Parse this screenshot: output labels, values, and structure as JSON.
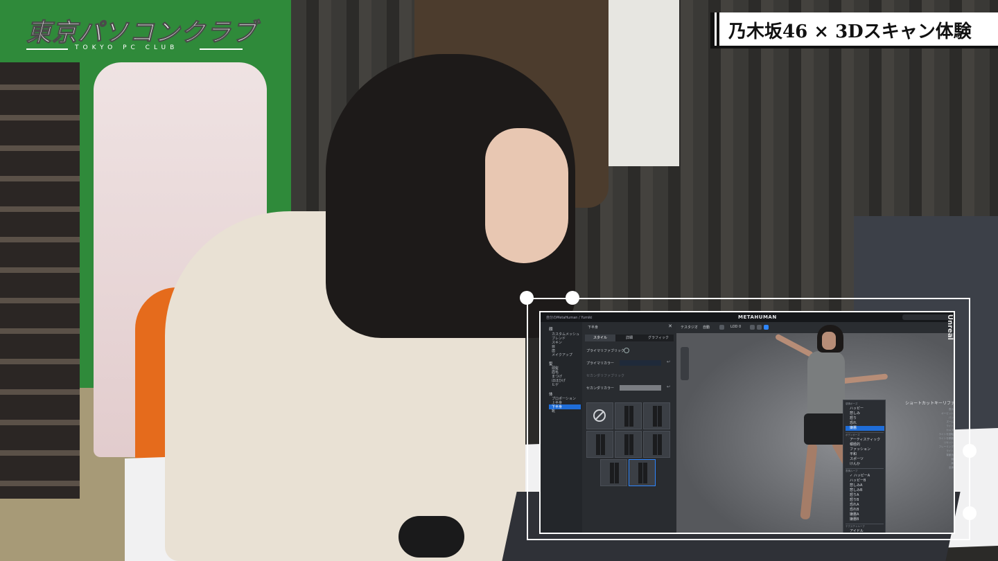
{
  "overlay": {
    "logo_text": "東京パソコンクラブ",
    "logo_subtext": "TOKYO PC CLUB",
    "ticker_title": "乃木坂46 × 3Dスキャン体験"
  },
  "app": {
    "brand": "METAHUMAN",
    "breadcrumb": "自分のMetaHuman / Yumiki",
    "panel_title": "下半身",
    "panel_close": "✕",
    "tabs": [
      {
        "label": "スタイル"
      },
      {
        "label": "詳細"
      },
      {
        "label": "グラフィック"
      }
    ],
    "sidebar": {
      "groups": [
        {
          "label": "顔",
          "items": [
            "カスタムメッシュ",
            "ブレンド",
            "スキン",
            "目",
            "歯",
            "メイクアップ"
          ]
        },
        {
          "label": "髪",
          "items": [
            "頭髪",
            "眉毛",
            "まつげ",
            "ほほひげ",
            "ヒゲ"
          ]
        },
        {
          "label": "体",
          "items": [
            "プロポーション",
            "上半身",
            "下半身",
            "靴"
          ]
        }
      ],
      "selected": "下半身"
    },
    "properties": [
      {
        "label": "プライマリファブリック"
      },
      {
        "label": "プライマリカラー"
      },
      {
        "label": "セカンダリファブリック"
      },
      {
        "label": "セカンダリカラー"
      }
    ],
    "reset_icon": "↩",
    "viewport_toolbar": [
      "テスタジオ",
      "自動",
      "LOD 0"
    ],
    "dropdown": {
      "sections": [
        {
          "header": "感情ポーズ",
          "items": [
            "ハッピー",
            "悲しみ",
            "怒り",
            "恐れ",
            "嫌悪"
          ],
          "selected": "嫌悪"
        },
        {
          "header": "ボディポーズ",
          "items": [
            "アーティスティック",
            "積極的",
            "ファッション",
            "平和",
            "スポーツ",
            "けんか"
          ]
        },
        {
          "header": "表情ループ",
          "items": [
            "✓ ハッピーA",
            "ハッピーB",
            "悲しみA",
            "悲しみB",
            "怒りA",
            "怒りB",
            "恐れA",
            "恐れB",
            "嫌悪A",
            "嫌悪B"
          ]
        },
        {
          "header": "テクスチャループ",
          "items": [
            "アイドル"
          ]
        }
      ]
    },
    "shortcuts": {
      "title": "ショートカットキーリファ",
      "rows": [
        "表示",
        "オービット",
        "パン",
        "ズーム",
        "ライト",
        "カメラ",
        "ライトを回転",
        "ライトを移動",
        "リセット",
        "フレーミング",
        "ライト",
        "背景色",
        "顔",
        "体",
        "全身"
      ]
    },
    "watermark": "Unreal"
  },
  "icons": {
    "none_icon": "no-entry-icon",
    "reset_icon": "undo-icon"
  }
}
